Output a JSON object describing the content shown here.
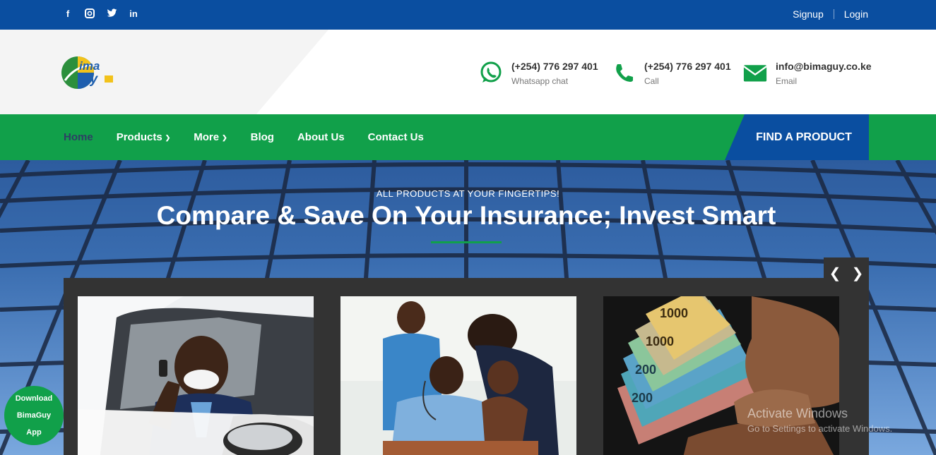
{
  "topbar": {
    "social": [
      {
        "name": "facebook-icon",
        "glyph": "f"
      },
      {
        "name": "instagram-icon",
        "glyph": "◙"
      },
      {
        "name": "twitter-icon",
        "glyph": "🐦"
      },
      {
        "name": "linkedin-icon",
        "glyph": "in"
      }
    ],
    "signup": "Signup",
    "login": "Login"
  },
  "header": {
    "logo_text": "BimaGuy",
    "contacts": [
      {
        "icon": "whatsapp-icon",
        "main": "(+254) 776 297 401",
        "sub": "Whatsapp chat"
      },
      {
        "icon": "phone-icon",
        "main": "(+254) 776 297 401",
        "sub": "Call"
      },
      {
        "icon": "envelope-icon",
        "main": "info@bimaguy.co.ke",
        "sub": "Email"
      }
    ]
  },
  "nav": {
    "items": [
      {
        "label": "Home",
        "active": true
      },
      {
        "label": "Products",
        "dropdown": true
      },
      {
        "label": "More",
        "dropdown": true
      },
      {
        "label": "Blog"
      },
      {
        "label": "About Us"
      },
      {
        "label": "Contact Us"
      }
    ],
    "find_button": "FIND A PRODUCT"
  },
  "hero": {
    "tagline": "ALL PRODUCTS AT YOUR FINGERTIPS!",
    "title": "Compare & Save On Your Insurance; Invest Smart"
  },
  "carousel": {
    "prev": "‹",
    "next": "›"
  },
  "download": {
    "line1": "Download",
    "line2": "BimaGuy",
    "line3": "App"
  },
  "watermark": {
    "title": "Activate Windows",
    "sub": "Go to Settings to activate Windows."
  },
  "colors": {
    "brand_blue": "#0a4ea0",
    "brand_green": "#11a04a"
  }
}
